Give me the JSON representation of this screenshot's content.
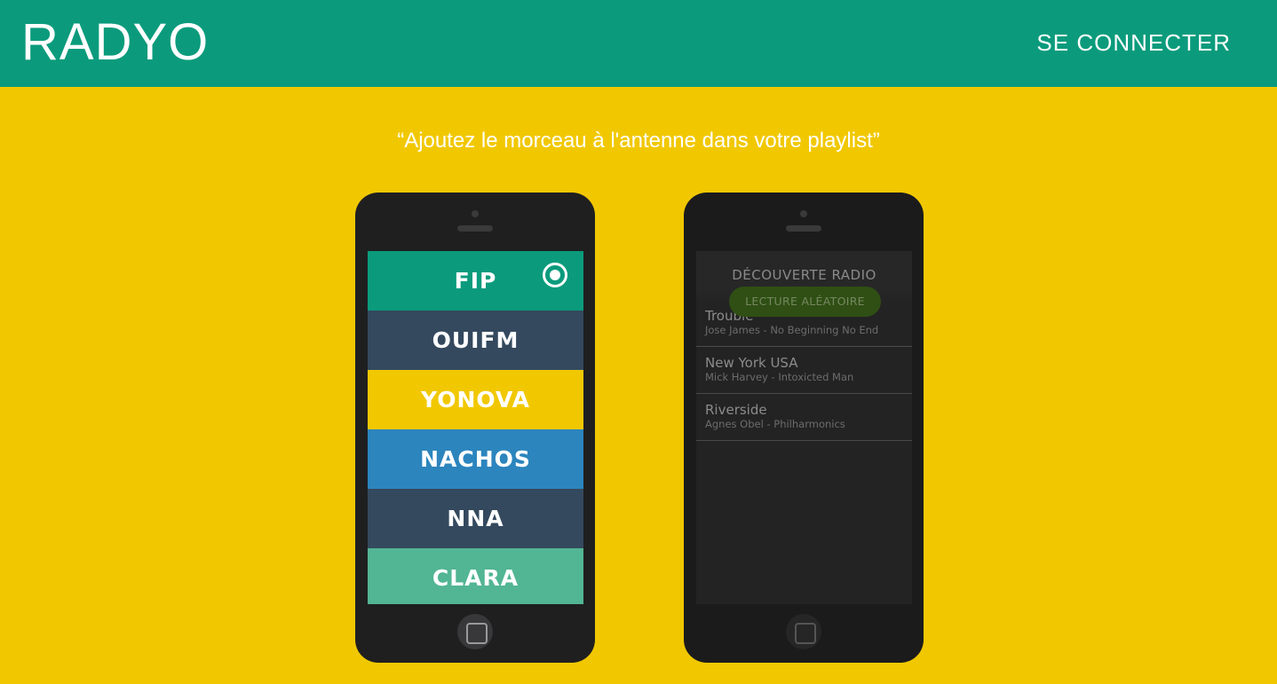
{
  "header": {
    "logo": "RADYO",
    "login_label": "SE CONNECTER"
  },
  "tagline": "“Ajoutez le morceau à l'antenne dans votre playlist”",
  "phone_left": {
    "stations": [
      {
        "label": "FIP",
        "color": "#0b9b7c",
        "selected": true
      },
      {
        "label": "OUIFM",
        "color": "#34495e",
        "selected": false
      },
      {
        "label": "YONOVA",
        "color": "#f1c800",
        "selected": false
      },
      {
        "label": "NACHOS",
        "color": "#2c85bd",
        "selected": false
      },
      {
        "label": "NNA",
        "color": "#34495e",
        "selected": false
      },
      {
        "label": "CLARA",
        "color": "#52b593",
        "selected": false
      }
    ]
  },
  "phone_right": {
    "title": "DÉCOUVERTE RADIO",
    "random_button": "LECTURE ALÉATOIRE",
    "tracks": [
      {
        "title": "Trouble",
        "subtitle": "Jose James - No Beginning No End"
      },
      {
        "title": "New York USA",
        "subtitle": "Mick Harvey - Intoxicted Man"
      },
      {
        "title": "Riverside",
        "subtitle": "Agnes Obel - Philharmonics"
      }
    ]
  },
  "icons": {
    "selected_station": "radio-selected-icon",
    "home": "home-button-icon"
  },
  "colors": {
    "header_bg": "#0b9b7c",
    "page_bg": "#f1c800",
    "phone_body": "#1f1f20"
  }
}
